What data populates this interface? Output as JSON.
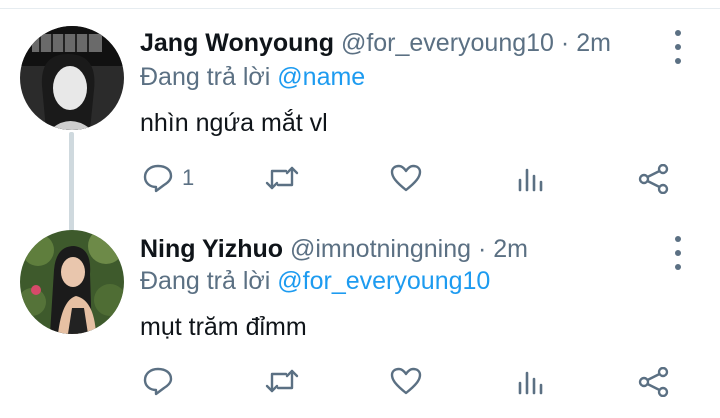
{
  "tweets": [
    {
      "name": "Jang Wonyoung",
      "handle": "@for_everyoung10",
      "separator": "·",
      "time": "2m",
      "replying_prefix": "Đang trả lời",
      "replying_to": "@name",
      "text": "nhìn ngứa mắt vl",
      "reply_count": "1"
    },
    {
      "name": "Ning Yizhuo",
      "handle": "@imnotningning",
      "separator": "·",
      "time": "2m",
      "replying_prefix": "Đang trả lời",
      "replying_to": "@for_everyoung10",
      "text": "mụt trăm đỉmm",
      "reply_count": ""
    }
  ],
  "icons": [
    "reply-icon",
    "retweet-icon",
    "like-icon",
    "analytics-icon",
    "share-icon",
    "more-options-icon"
  ],
  "colors": {
    "accent": "#1d9bf0",
    "secondary_text": "#5b7083",
    "primary_text": "#0f1419",
    "thread_line": "#cfd9de"
  }
}
